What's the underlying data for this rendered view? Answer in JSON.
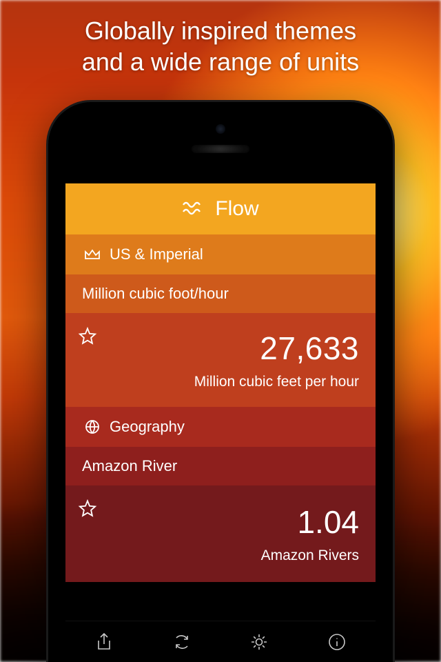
{
  "headline": {
    "line1": "Globally inspired themes",
    "line2": "and a wide range of units"
  },
  "app": {
    "title": "Flow",
    "group1": {
      "label": "US & Imperial",
      "unit": "Million cubic foot/hour"
    },
    "value1": {
      "number": "27,633",
      "unit_label": "Million cubic feet per hour"
    },
    "group2": {
      "label": "Geography",
      "unit": "Amazon River"
    },
    "value2": {
      "number": "1.04",
      "unit_label": "Amazon Rivers"
    }
  },
  "toolbar": {
    "share": "share",
    "refresh": "refresh",
    "settings": "settings",
    "info": "info"
  }
}
